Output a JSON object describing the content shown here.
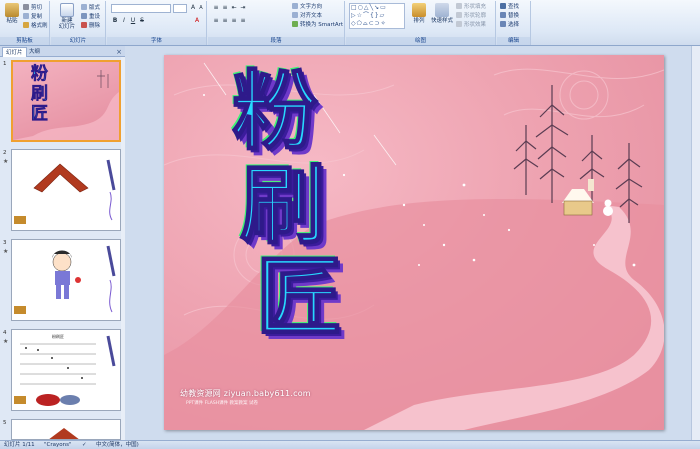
{
  "ribbon": {
    "clipboard": {
      "label": "剪贴板",
      "paste": "粘贴",
      "cut": "剪切",
      "copy": "复制",
      "format_painter": "格式刷"
    },
    "slides": {
      "label": "幻灯片",
      "new_slide": "新建\n幻灯片",
      "layout": "版式",
      "reset": "重设",
      "delete": "删除"
    },
    "font": {
      "label": "字体",
      "font_name": "",
      "font_size": "",
      "bold": "B",
      "italic": "I",
      "underline": "U",
      "strike": "S",
      "font_color": "A"
    },
    "paragraph": {
      "label": "段落",
      "text_direction": "文字方向",
      "align_text": "对齐文本",
      "smartart": "转换为 SmartArt"
    },
    "drawing": {
      "label": "绘图",
      "arrange": "排列",
      "quick_styles": "快速样式",
      "shape_fill": "形状填充",
      "shape_outline": "形状轮廓",
      "shape_effects": "形状效果"
    },
    "editing": {
      "label": "编辑",
      "find": "查找",
      "replace": "替换",
      "select": "选择"
    }
  },
  "panel": {
    "tabs": [
      "幻灯片",
      "大纲"
    ],
    "close": "×",
    "slides": [
      {
        "num": "1"
      },
      {
        "num": "2"
      },
      {
        "num": "3"
      },
      {
        "num": "4",
        "title": "粉刷匠"
      },
      {
        "num": "5"
      }
    ]
  },
  "slide": {
    "chars": [
      "粉",
      "刷",
      "匠"
    ],
    "watermark": "幼教资源网 ziyuan.baby611.com",
    "watermark_sub": "PPT课件 FLASH课件 教案教案 试卷"
  },
  "status": {
    "slide_pos": "幻灯片 1/11",
    "theme": "\"Crayons\"",
    "language": "中文(简体，中国)"
  },
  "colors": {
    "accent": "#15428b",
    "slide_bg": "#eea3b1",
    "selection": "#f0a030"
  }
}
